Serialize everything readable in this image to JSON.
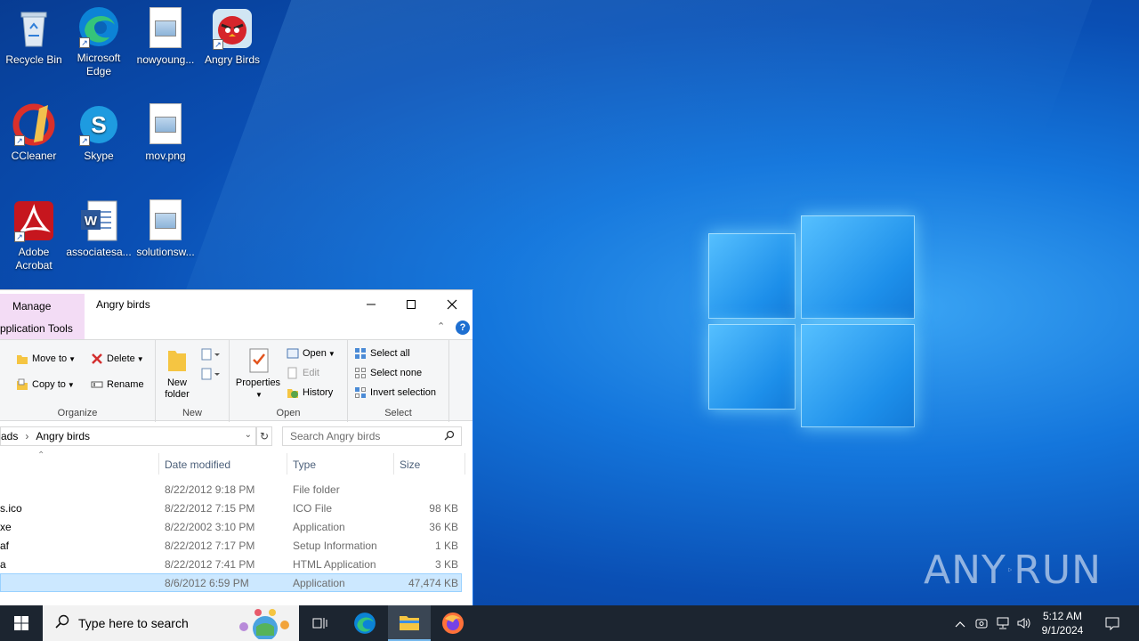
{
  "desktop": {
    "icons": [
      {
        "label": "Recycle Bin",
        "icon": "recycle-bin-icon"
      },
      {
        "label": "Microsoft Edge",
        "icon": "edge-icon"
      },
      {
        "label": "nowyoung...",
        "icon": "image-file-icon"
      },
      {
        "label": "Angry Birds",
        "icon": "angry-birds-icon"
      },
      {
        "label": "CCleaner",
        "icon": "ccleaner-icon"
      },
      {
        "label": "Skype",
        "icon": "skype-icon"
      },
      {
        "label": "mov.png",
        "icon": "image-file-icon"
      },
      {
        "label": "Adobe Acrobat",
        "icon": "acrobat-icon"
      },
      {
        "label": "associatesa...",
        "icon": "word-doc-icon"
      },
      {
        "label": "solutionsw...",
        "icon": "image-file-icon"
      }
    ]
  },
  "explorer": {
    "manage_tab": "Manage",
    "title": "Angry birds",
    "app_tools_tab": "pplication Tools",
    "ribbon": {
      "organize": {
        "label": "Organize",
        "move_to": "Move to",
        "copy_to": "Copy to",
        "delete": "Delete",
        "rename": "Rename"
      },
      "new": {
        "label": "New",
        "new_folder": "New folder"
      },
      "open": {
        "label": "Open",
        "properties": "Properties",
        "open": "Open",
        "edit": "Edit",
        "history": "History"
      },
      "select": {
        "label": "Select",
        "select_all": "Select all",
        "select_none": "Select none",
        "invert_selection": "Invert selection"
      }
    },
    "address": {
      "prefix": "ads",
      "current": "Angry birds"
    },
    "search_placeholder": "Search Angry birds",
    "columns": {
      "date": "Date modified",
      "type": "Type",
      "size": "Size"
    },
    "files": [
      {
        "name": "",
        "date": "8/22/2012 9:18 PM",
        "type": "File folder",
        "size": ""
      },
      {
        "name": "s.ico",
        "date": "8/22/2012 7:15 PM",
        "type": "ICO File",
        "size": "98 KB"
      },
      {
        "name": "xe",
        "date": "8/22/2002 3:10 PM",
        "type": "Application",
        "size": "36 KB"
      },
      {
        "name": "af",
        "date": "8/22/2012 7:17 PM",
        "type": "Setup Information",
        "size": "1 KB"
      },
      {
        "name": "a",
        "date": "8/22/2012 7:41 PM",
        "type": "HTML Application",
        "size": "3 KB"
      },
      {
        "name": "",
        "date": "8/6/2012 6:59 PM",
        "type": "Application",
        "size": "47,474 KB"
      }
    ]
  },
  "taskbar": {
    "search_placeholder": "Type here to search",
    "time": "5:12 AM",
    "date": "9/1/2024"
  },
  "watermark": {
    "left": "ANY",
    "right": "RUN"
  },
  "colors": {
    "accent": "#1a73e8",
    "selection": "#cce8ff",
    "manage_tab": "#f3dcf5",
    "taskbar": "#1c2530"
  }
}
